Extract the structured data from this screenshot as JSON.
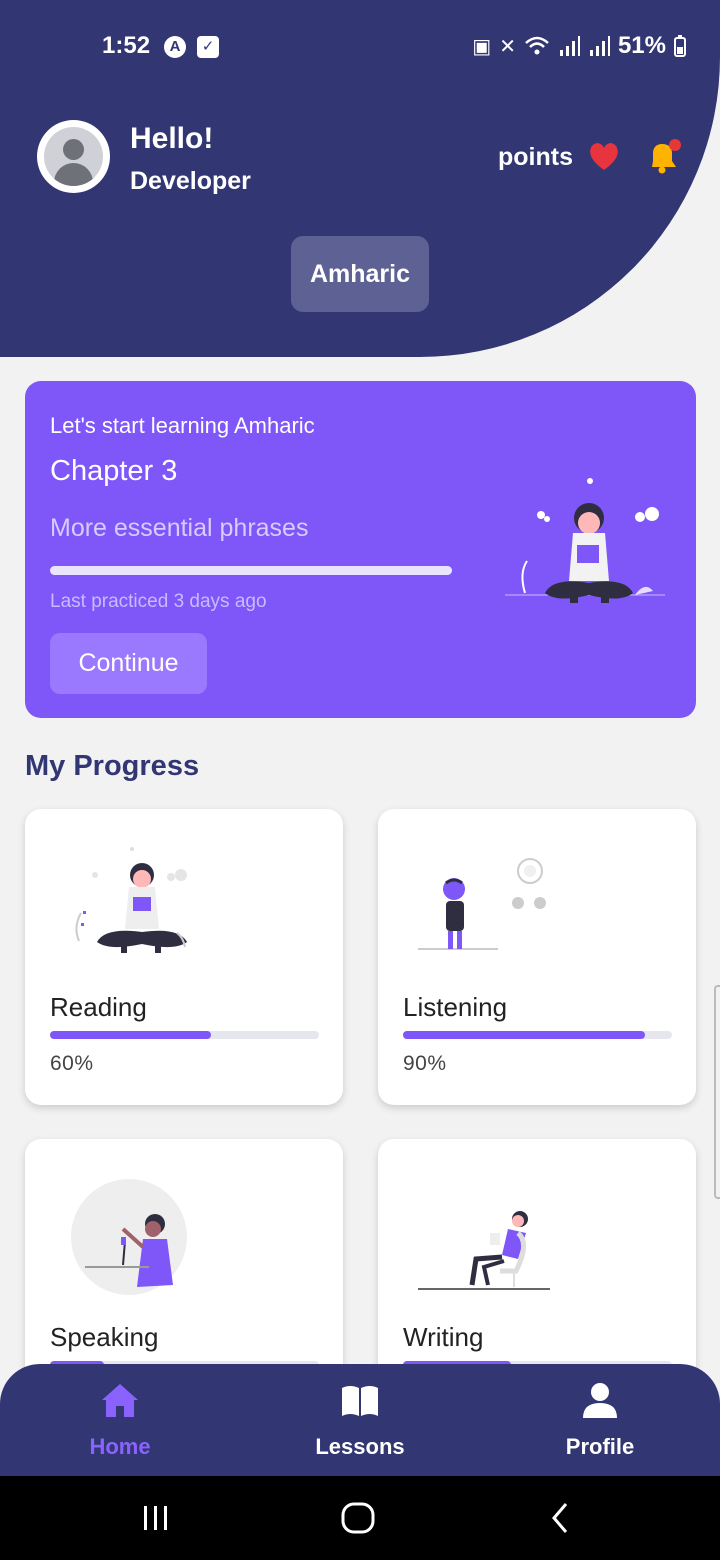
{
  "status_bar": {
    "time": "1:52",
    "battery": "51%",
    "icons": [
      "nav-a-icon",
      "check-square-icon",
      "battery-saver-icon",
      "mute-icon",
      "wifi-icon",
      "signal-icon",
      "signal-icon",
      "charging-icon"
    ]
  },
  "header": {
    "greeting": "Hello!",
    "username": "Developer",
    "points_label": "points",
    "language_button": "Amharic",
    "colors": {
      "background": "#323672",
      "heart": "#e8343f",
      "bell": "#ffb300"
    }
  },
  "hero": {
    "pretitle": "Let's start learning Amharic",
    "title": "Chapter 3",
    "subtitle": "More essential phrases",
    "progress": 1.0,
    "last_practiced": "Last practiced 3 days ago",
    "button": "Continue",
    "color": "#7f56f8"
  },
  "section_title": "My Progress",
  "progress_cards": [
    {
      "label": "Reading",
      "percent_text": "60%",
      "progress": 0.6
    },
    {
      "label": "Listening",
      "percent_text": "90%",
      "progress": 0.9
    },
    {
      "label": "Speaking",
      "progress": 0.2
    },
    {
      "label": "Writing",
      "progress": 0.4
    }
  ],
  "bottom_nav": {
    "items": [
      {
        "label": "Home",
        "icon": "home-icon",
        "active": true
      },
      {
        "label": "Lessons",
        "icon": "book-icon",
        "active": false
      },
      {
        "label": "Profile",
        "icon": "user-icon",
        "active": false
      }
    ],
    "active_color": "#8a63ff"
  },
  "system_nav": [
    "recents-icon",
    "home-circle-icon",
    "back-icon"
  ]
}
